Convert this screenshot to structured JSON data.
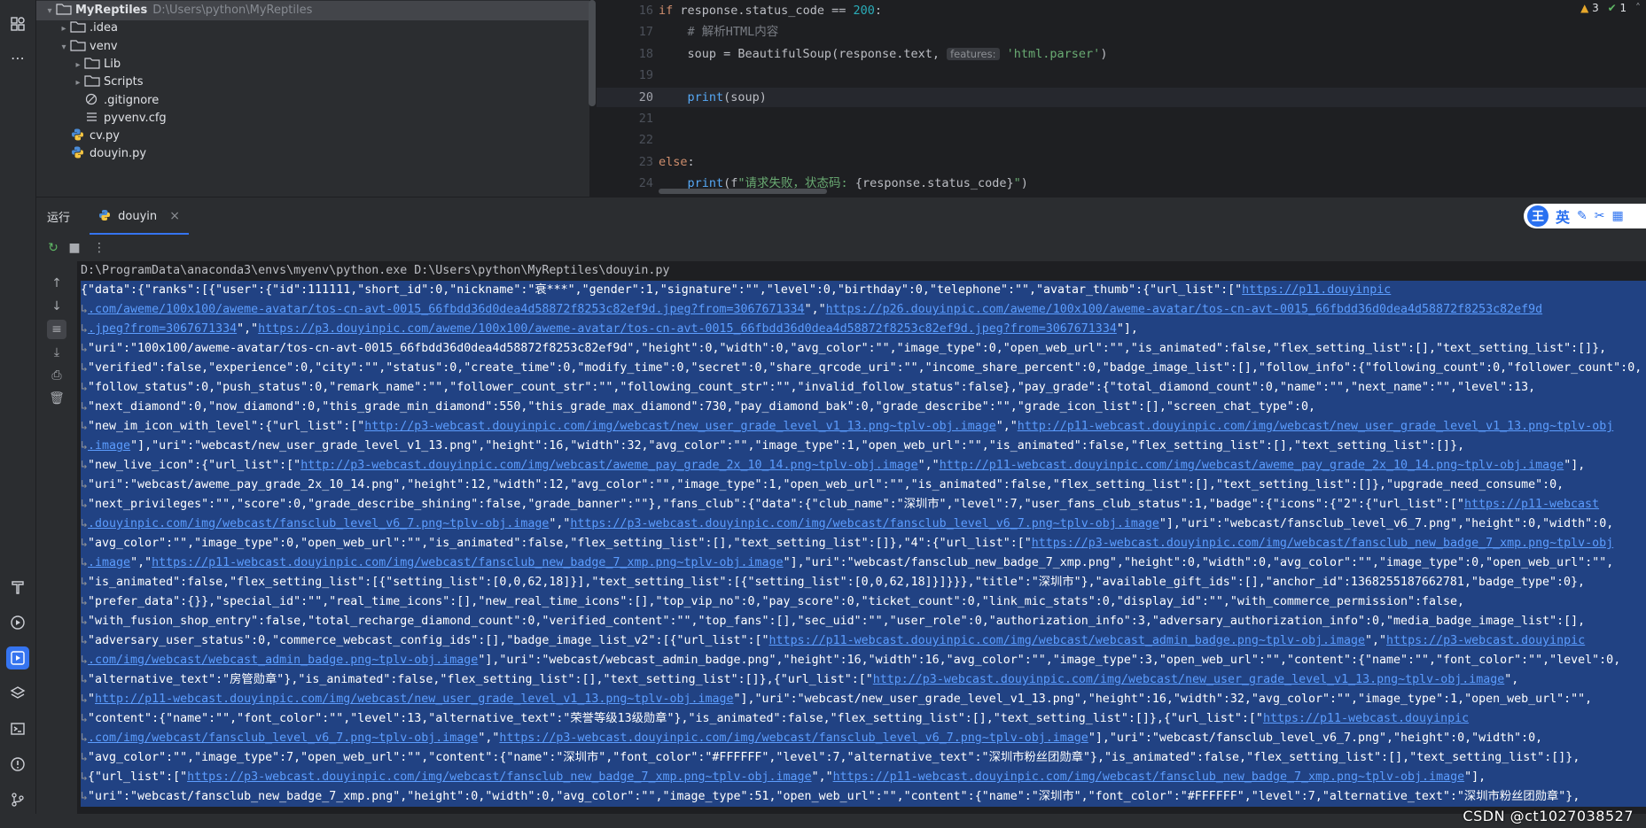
{
  "project_tree": {
    "items": [
      {
        "label": "MyReptiles",
        "path": "D:\\Users\\python\\MyReptiles",
        "kind": "folder",
        "expanded": true,
        "depth": 0,
        "selected": true,
        "bold": true
      },
      {
        "label": ".idea",
        "path": "",
        "kind": "folder",
        "expanded": false,
        "depth": 1
      },
      {
        "label": "venv",
        "path": "",
        "kind": "folder",
        "expanded": true,
        "depth": 1
      },
      {
        "label": "Lib",
        "path": "",
        "kind": "folder",
        "expanded": false,
        "depth": 2
      },
      {
        "label": "Scripts",
        "path": "",
        "kind": "folder",
        "expanded": false,
        "depth": 2
      },
      {
        "label": ".gitignore",
        "path": "",
        "kind": "ignore",
        "expanded": null,
        "depth": 2
      },
      {
        "label": "pyvenv.cfg",
        "path": "",
        "kind": "cfg",
        "expanded": null,
        "depth": 2
      },
      {
        "label": "cv.py",
        "path": "",
        "kind": "python",
        "expanded": null,
        "depth": 1
      },
      {
        "label": "douyin.py",
        "path": "",
        "kind": "python",
        "expanded": null,
        "depth": 1
      }
    ]
  },
  "editor": {
    "inspections": {
      "warnings": "3",
      "ok": "1"
    },
    "lines": [
      {
        "n": "16",
        "current": false,
        "parts": [
          [
            "kw",
            "if"
          ],
          [
            "plain",
            " response.status_code == "
          ],
          [
            "num",
            "200"
          ],
          [
            "plain",
            ":"
          ]
        ]
      },
      {
        "n": "17",
        "current": false,
        "parts": [
          [
            "plain",
            "    "
          ],
          [
            "cmt",
            "# 解析HTML内容"
          ]
        ]
      },
      {
        "n": "18",
        "current": false,
        "parts": [
          [
            "plain",
            "    soup = BeautifulSoup(response.text, "
          ],
          [
            "hint",
            "features:"
          ],
          [
            "plain",
            " "
          ],
          [
            "str",
            "'html.parser'"
          ],
          [
            "plain",
            ")"
          ]
        ]
      },
      {
        "n": "19",
        "current": false,
        "parts": []
      },
      {
        "n": "20",
        "current": true,
        "parts": [
          [
            "plain",
            "    "
          ],
          [
            "fn",
            "print"
          ],
          [
            "plain",
            "(soup)"
          ]
        ]
      },
      {
        "n": "21",
        "current": false,
        "parts": []
      },
      {
        "n": "22",
        "current": false,
        "parts": []
      },
      {
        "n": "23",
        "current": false,
        "parts": [
          [
            "kw",
            "else"
          ],
          [
            "plain",
            ":"
          ]
        ]
      },
      {
        "n": "24",
        "current": false,
        "parts": [
          [
            "plain",
            "    "
          ],
          [
            "fn",
            "print"
          ],
          [
            "plain",
            "(f"
          ],
          [
            "str",
            "\"请求失败，状态码: "
          ],
          [
            "plain",
            "{response.status_code}"
          ],
          [
            "str",
            "\""
          ],
          [
            "plain",
            ")"
          ]
        ]
      }
    ]
  },
  "run_panel": {
    "title": "运行",
    "tab_label": "douyin",
    "ime": {
      "logo": "王",
      "lang": "英"
    },
    "console_lines": [
      {
        "sel": false,
        "cmd": true,
        "wrap": false,
        "parts": [
          [
            "t",
            "D:\\ProgramData\\anaconda3\\envs\\myenv\\python.exe D:\\Users\\python\\MyReptiles\\douyin.py"
          ]
        ]
      },
      {
        "sel": true,
        "wrap": false,
        "parts": [
          [
            "t",
            "{\"data\":{\"ranks\":[{\"user\":{\"id\":111111,\"short_id\":0,\"nickname\":\"衰***\",\"gender\":1,\"signature\":\"\",\"level\":0,\"birthday\":0,\"telephone\":\"\",\"avatar_thumb\":{\"url_list\":[\""
          ],
          [
            "l",
            "https://p11.douyinpic"
          ]
        ]
      },
      {
        "sel": true,
        "wrap": true,
        "parts": [
          [
            "l",
            ".com/aweme/100x100/aweme-avatar/tos-cn-avt-0015_66fbdd36d0dea4d58872f8253c82ef9d.jpeg?from=3067671334"
          ],
          [
            "t",
            "\",\""
          ],
          [
            "l",
            "https://p26.douyinpic.com/aweme/100x100/aweme-avatar/tos-cn-avt-0015_66fbdd36d0dea4d58872f8253c82ef9d"
          ]
        ]
      },
      {
        "sel": true,
        "wrap": true,
        "parts": [
          [
            "l",
            ".jpeg?from=3067671334"
          ],
          [
            "t",
            "\",\""
          ],
          [
            "l",
            "https://p3.douyinpic.com/aweme/100x100/aweme-avatar/tos-cn-avt-0015_66fbdd36d0dea4d58872f8253c82ef9d.jpeg?from=3067671334"
          ],
          [
            "t",
            "\"],"
          ]
        ]
      },
      {
        "sel": true,
        "wrap": true,
        "parts": [
          [
            "t",
            "\"uri\":\"100x100/aweme-avatar/tos-cn-avt-0015_66fbdd36d0dea4d58872f8253c82ef9d\",\"height\":0,\"width\":0,\"avg_color\":\"\",\"image_type\":0,\"open_web_url\":\"\",\"is_animated\":false,\"flex_setting_list\":[],\"text_setting_list\":[]},"
          ]
        ]
      },
      {
        "sel": true,
        "wrap": true,
        "parts": [
          [
            "t",
            "\"verified\":false,\"experience\":0,\"city\":\"\",\"status\":0,\"create_time\":0,\"modify_time\":0,\"secret\":0,\"share_qrcode_uri\":\"\",\"income_share_percent\":0,\"badge_image_list\":[],\"follow_info\":{\"following_count\":0,\"follower_count\":0,"
          ]
        ]
      },
      {
        "sel": true,
        "wrap": true,
        "parts": [
          [
            "t",
            "\"follow_status\":0,\"push_status\":0,\"remark_name\":\"\",\"follower_count_str\":\"\",\"following_count_str\":\"\",\"invalid_follow_status\":false},\"pay_grade\":{\"total_diamond_count\":0,\"name\":\"\",\"next_name\":\"\",\"level\":13,"
          ]
        ]
      },
      {
        "sel": true,
        "wrap": true,
        "parts": [
          [
            "t",
            "\"next_diamond\":0,\"now_diamond\":0,\"this_grade_min_diamond\":550,\"this_grade_max_diamond\":730,\"pay_diamond_bak\":0,\"grade_describe\":\"\",\"grade_icon_list\":[],\"screen_chat_type\":0,"
          ]
        ]
      },
      {
        "sel": true,
        "wrap": true,
        "parts": [
          [
            "t",
            "\"new_im_icon_with_level\":{\"url_list\":[\""
          ],
          [
            "l",
            "http://p3-webcast.douyinpic.com/img/webcast/new_user_grade_level_v1_13.png~tplv-obj.image"
          ],
          [
            "t",
            "\",\""
          ],
          [
            "l",
            "http://p11-webcast.douyinpic.com/img/webcast/new_user_grade_level_v1_13.png~tplv-obj"
          ]
        ]
      },
      {
        "sel": true,
        "wrap": true,
        "parts": [
          [
            "l",
            ".image"
          ],
          [
            "t",
            "\"],\"uri\":\"webcast/new_user_grade_level_v1_13.png\",\"height\":16,\"width\":32,\"avg_color\":\"\",\"image_type\":1,\"open_web_url\":\"\",\"is_animated\":false,\"flex_setting_list\":[],\"text_setting_list\":[]},"
          ]
        ]
      },
      {
        "sel": true,
        "wrap": true,
        "parts": [
          [
            "t",
            "\"new_live_icon\":{\"url_list\":[\""
          ],
          [
            "l",
            "http://p3-webcast.douyinpic.com/img/webcast/aweme_pay_grade_2x_10_14.png~tplv-obj.image"
          ],
          [
            "t",
            "\",\""
          ],
          [
            "l",
            "http://p11-webcast.douyinpic.com/img/webcast/aweme_pay_grade_2x_10_14.png~tplv-obj.image"
          ],
          [
            "t",
            "\"],"
          ]
        ]
      },
      {
        "sel": true,
        "wrap": true,
        "parts": [
          [
            "t",
            "\"uri\":\"webcast/aweme_pay_grade_2x_10_14.png\",\"height\":12,\"width\":12,\"avg_color\":\"\",\"image_type\":1,\"open_web_url\":\"\",\"is_animated\":false,\"flex_setting_list\":[],\"text_setting_list\":[]},\"upgrade_need_consume\":0,"
          ]
        ]
      },
      {
        "sel": true,
        "wrap": true,
        "parts": [
          [
            "t",
            "\"next_privileges\":\"\",\"score\":0,\"grade_describe_shining\":false,\"grade_banner\":\"\"},\"fans_club\":{\"data\":{\"club_name\":\"深圳市\",\"level\":7,\"user_fans_club_status\":1,\"badge\":{\"icons\":{\"2\":{\"url_list\":[\""
          ],
          [
            "l",
            "https://p11-webcast"
          ]
        ]
      },
      {
        "sel": true,
        "wrap": true,
        "parts": [
          [
            "l",
            ".douyinpic.com/img/webcast/fansclub_level_v6_7.png~tplv-obj.image"
          ],
          [
            "t",
            "\",\""
          ],
          [
            "l",
            "https://p3-webcast.douyinpic.com/img/webcast/fansclub_level_v6_7.png~tplv-obj.image"
          ],
          [
            "t",
            "\"],\"uri\":\"webcast/fansclub_level_v6_7.png\",\"height\":0,\"width\":0,"
          ]
        ]
      },
      {
        "sel": true,
        "wrap": true,
        "parts": [
          [
            "t",
            "\"avg_color\":\"\",\"image_type\":0,\"open_web_url\":\"\",\"is_animated\":false,\"flex_setting_list\":[],\"text_setting_list\":[]},\"4\":{\"url_list\":[\""
          ],
          [
            "l",
            "https://p3-webcast.douyinpic.com/img/webcast/fansclub_new_badge_7_xmp.png~tplv-obj"
          ]
        ]
      },
      {
        "sel": true,
        "wrap": true,
        "parts": [
          [
            "l",
            ".image"
          ],
          [
            "t",
            "\",\""
          ],
          [
            "l",
            "https://p11-webcast.douyinpic.com/img/webcast/fansclub_new_badge_7_xmp.png~tplv-obj.image"
          ],
          [
            "t",
            "\"],\"uri\":\"webcast/fansclub_new_badge_7_xmp.png\",\"height\":0,\"width\":0,\"avg_color\":\"\",\"image_type\":0,\"open_web_url\":\"\","
          ]
        ]
      },
      {
        "sel": true,
        "wrap": true,
        "parts": [
          [
            "t",
            "\"is_animated\":false,\"flex_setting_list\":[{\"setting_list\":[0,0,62,18]}],\"text_setting_list\":[{\"setting_list\":[0,0,62,18]}]}}},\"title\":\"深圳市\"},\"available_gift_ids\":[],\"anchor_id\":1368255187662781,\"badge_type\":0},"
          ]
        ]
      },
      {
        "sel": true,
        "wrap": true,
        "parts": [
          [
            "t",
            "\"prefer_data\":{}},\"special_id\":\"\",\"real_time_icons\":[],\"new_real_time_icons\":[],\"top_vip_no\":0,\"pay_score\":0,\"ticket_count\":0,\"link_mic_stats\":0,\"display_id\":\"\",\"with_commerce_permission\":false,"
          ]
        ]
      },
      {
        "sel": true,
        "wrap": true,
        "parts": [
          [
            "t",
            "\"with_fusion_shop_entry\":false,\"total_recharge_diamond_count\":0,\"verified_content\":\"\",\"top_fans\":[],\"sec_uid\":\"\",\"user_role\":0,\"authorization_info\":3,\"adversary_authorization_info\":0,\"media_badge_image_list\":[],"
          ]
        ]
      },
      {
        "sel": true,
        "wrap": true,
        "parts": [
          [
            "t",
            "\"adversary_user_status\":0,\"commerce_webcast_config_ids\":[],\"badge_image_list_v2\":[{\"url_list\":[\""
          ],
          [
            "l",
            "https://p11-webcast.douyinpic.com/img/webcast/webcast_admin_badge.png~tplv-obj.image"
          ],
          [
            "t",
            "\",\""
          ],
          [
            "l",
            "https://p3-webcast.douyinpic"
          ]
        ]
      },
      {
        "sel": true,
        "wrap": true,
        "parts": [
          [
            "l",
            ".com/img/webcast/webcast_admin_badge.png~tplv-obj.image"
          ],
          [
            "t",
            "\"],\"uri\":\"webcast/webcast_admin_badge.png\",\"height\":16,\"width\":16,\"avg_color\":\"\",\"image_type\":3,\"open_web_url\":\"\",\"content\":{\"name\":\"\",\"font_color\":\"\",\"level\":0,"
          ]
        ]
      },
      {
        "sel": true,
        "wrap": true,
        "parts": [
          [
            "t",
            "\"alternative_text\":\"房管勋章\"},\"is_animated\":false,\"flex_setting_list\":[],\"text_setting_list\":[]},{\"url_list\":[\""
          ],
          [
            "l",
            "http://p3-webcast.douyinpic.com/img/webcast/new_user_grade_level_v1_13.png~tplv-obj.image"
          ],
          [
            "t",
            "\","
          ]
        ]
      },
      {
        "sel": true,
        "wrap": true,
        "parts": [
          [
            "t",
            "\""
          ],
          [
            "l",
            "http://p11-webcast.douyinpic.com/img/webcast/new_user_grade_level_v1_13.png~tplv-obj.image"
          ],
          [
            "t",
            "\"],\"uri\":\"webcast/new_user_grade_level_v1_13.png\",\"height\":16,\"width\":32,\"avg_color\":\"\",\"image_type\":1,\"open_web_url\":\"\","
          ]
        ]
      },
      {
        "sel": true,
        "wrap": true,
        "parts": [
          [
            "t",
            "\"content\":{\"name\":\"\",\"font_color\":\"\",\"level\":13,\"alternative_text\":\"荣誉等级13级勋章\"},\"is_animated\":false,\"flex_setting_list\":[],\"text_setting_list\":[]},{\"url_list\":[\""
          ],
          [
            "l",
            "https://p11-webcast.douyinpic"
          ]
        ]
      },
      {
        "sel": true,
        "wrap": true,
        "parts": [
          [
            "l",
            ".com/img/webcast/fansclub_level_v6_7.png~tplv-obj.image"
          ],
          [
            "t",
            "\",\""
          ],
          [
            "l",
            "https://p3-webcast.douyinpic.com/img/webcast/fansclub_level_v6_7.png~tplv-obj.image"
          ],
          [
            "t",
            "\"],\"uri\":\"webcast/fansclub_level_v6_7.png\",\"height\":0,\"width\":0,"
          ]
        ]
      },
      {
        "sel": true,
        "wrap": true,
        "parts": [
          [
            "t",
            "\"avg_color\":\"\",\"image_type\":7,\"open_web_url\":\"\",\"content\":{\"name\":\"深圳市\",\"font_color\":\"#FFFFFF\",\"level\":7,\"alternative_text\":\"深圳市粉丝团勋章\"},\"is_animated\":false,\"flex_setting_list\":[],\"text_setting_list\":[]},"
          ]
        ]
      },
      {
        "sel": true,
        "wrap": true,
        "parts": [
          [
            "t",
            "{\"url_list\":[\""
          ],
          [
            "l",
            "https://p3-webcast.douyinpic.com/img/webcast/fansclub_new_badge_7_xmp.png~tplv-obj.image"
          ],
          [
            "t",
            "\",\""
          ],
          [
            "l",
            "https://p11-webcast.douyinpic.com/img/webcast/fansclub_new_badge_7_xmp.png~tplv-obj.image"
          ],
          [
            "t",
            "\"],"
          ]
        ]
      },
      {
        "sel": true,
        "wrap": true,
        "parts": [
          [
            "t",
            "\"uri\":\"webcast/fansclub_new_badge_7_xmp.png\",\"height\":0,\"width\":0,\"avg_color\":\"\",\"image_type\":51,\"open_web_url\":\"\",\"content\":{\"name\":\"深圳市\",\"font_color\":\"#FFFFFF\",\"level\":7,\"alternative_text\":\"深圳市粉丝团勋章\"},"
          ]
        ]
      }
    ]
  },
  "watermark": "CSDN @ct1027038527",
  "colors": {
    "accent": "#3574f0",
    "selection": "#214283",
    "link": "#5c9dff"
  }
}
